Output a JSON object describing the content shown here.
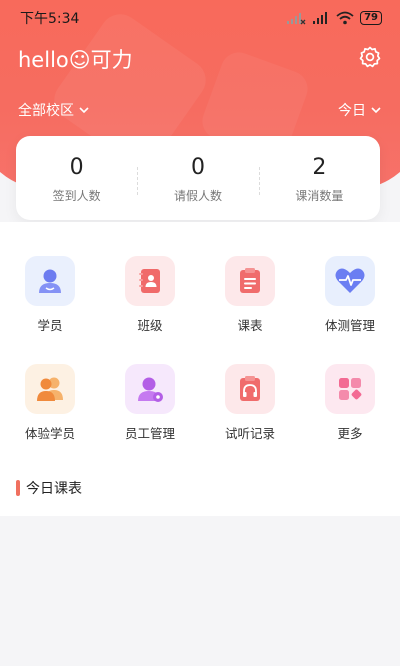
{
  "status_bar": {
    "time": "下午5:34",
    "battery": "79"
  },
  "header": {
    "greeting": "hello☺可力",
    "campus_selector": "全部校区",
    "period_selector": "今日"
  },
  "stats": [
    {
      "value": "0",
      "label": "签到人数"
    },
    {
      "value": "0",
      "label": "请假人数"
    },
    {
      "value": "2",
      "label": "课消数量"
    }
  ],
  "menu": [
    {
      "label": "学员",
      "icon": "student-icon"
    },
    {
      "label": "班级",
      "icon": "class-icon"
    },
    {
      "label": "课表",
      "icon": "schedule-icon"
    },
    {
      "label": "体测管理",
      "icon": "fitness-test-icon"
    },
    {
      "label": "体验学员",
      "icon": "trial-student-icon"
    },
    {
      "label": "员工管理",
      "icon": "staff-icon"
    },
    {
      "label": "试听记录",
      "icon": "trial-record-icon"
    },
    {
      "label": "更多",
      "icon": "more-icon"
    }
  ],
  "section": {
    "title": "今日课表"
  },
  "colors": {
    "header": "#f86a5b",
    "accent": "#f0705f"
  }
}
